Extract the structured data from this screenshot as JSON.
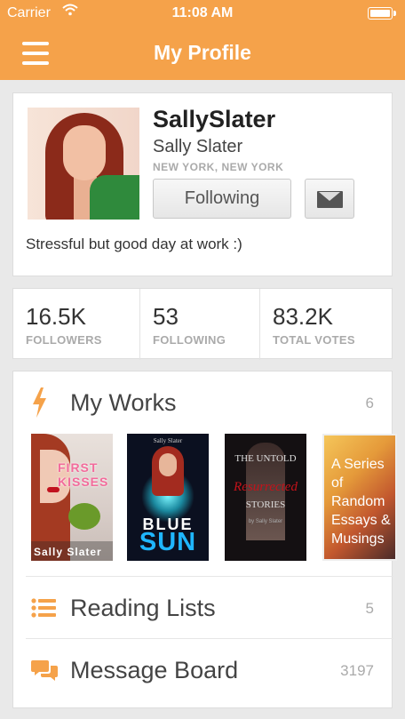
{
  "status_bar": {
    "carrier": "Carrier",
    "time": "11:08 AM"
  },
  "nav": {
    "title": "My Profile",
    "menu_icon": "hamburger-menu-icon"
  },
  "colors": {
    "brand": "#f5a24a",
    "background": "#e9e9e9"
  },
  "profile": {
    "username": "SallySlater",
    "full_name": "Sally Slater",
    "location": "NEW YORK, NEW YORK",
    "follow_label": "Following",
    "status": "Stressful but good day at work :)"
  },
  "stats": [
    {
      "value": "16.5K",
      "label": "FOLLOWERS"
    },
    {
      "value": "53",
      "label": "FOLLOWING"
    },
    {
      "value": "83.2K",
      "label": "TOTAL VOTES"
    }
  ],
  "works": {
    "label": "My Works",
    "count": "6",
    "covers": [
      {
        "title": "FIRST KISSES",
        "author": "Sally Slater"
      },
      {
        "title_line1": "BLUE",
        "title_line2": "SUN",
        "author": "Sally Slater"
      },
      {
        "top": "THE UNTOLD",
        "middle": "Resurrected",
        "bottom": "STORIES",
        "author": "by Sally Slater"
      },
      {
        "title": "A Series of Random Essays & Musings"
      }
    ]
  },
  "reading_lists": {
    "label": "Reading Lists",
    "count": "5"
  },
  "message_board": {
    "label": "Message Board",
    "count": "3197"
  }
}
